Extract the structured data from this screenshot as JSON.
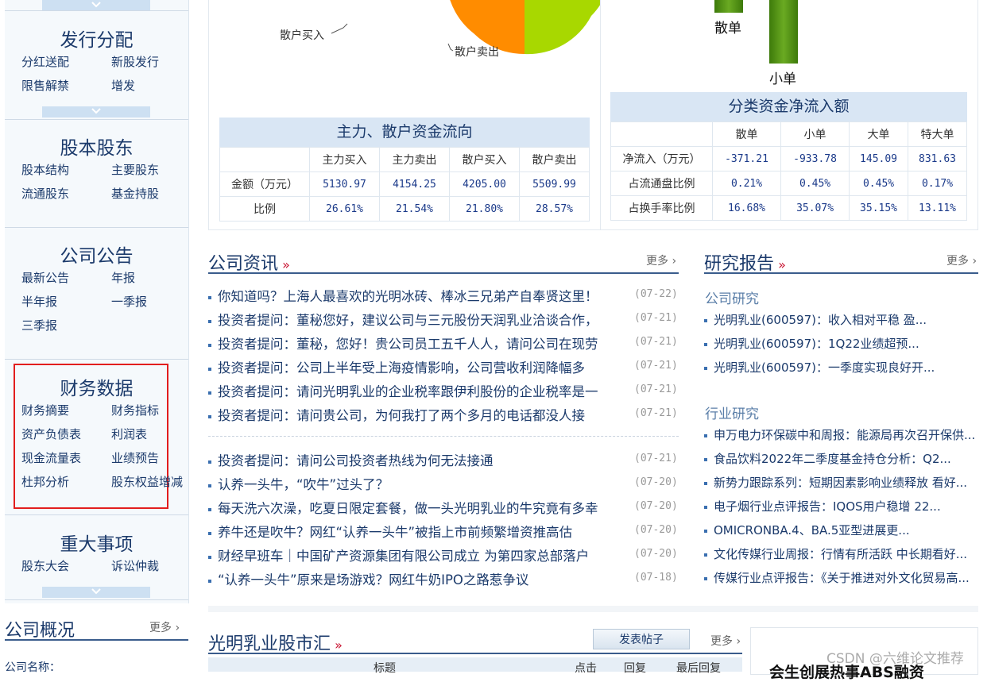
{
  "sidebar": {
    "sections": [
      {
        "title": "发行分配",
        "items": [
          "分红送配",
          "新股发行",
          "限售解禁",
          "增发"
        ]
      },
      {
        "title": "股本股东",
        "items": [
          "股本结构",
          "主要股东",
          "流通股东",
          "基金持股"
        ]
      },
      {
        "title": "公司公告",
        "items": [
          "最新公告",
          "年报",
          "半年报",
          "一季报",
          "三季报"
        ]
      },
      {
        "title": "财务数据",
        "items": [
          "财务摘要",
          "财务指标",
          "资产负债表",
          "利润表",
          "现金流量表",
          "业绩预告",
          "杜邦分析",
          "股东权益增减"
        ]
      },
      {
        "title": "重大事项",
        "items": [
          "股东大会",
          "诉讼仲裁"
        ]
      }
    ],
    "overview": {
      "title": "公司概况",
      "more": "更多",
      "first_field": "公司名称："
    }
  },
  "flow_pie": {
    "labels": [
      "散户买入",
      "散户卖出"
    ],
    "colors": [
      "#ff8c00",
      "#a8d800"
    ]
  },
  "flow_bar": {
    "labels": [
      "散单",
      "小单"
    ],
    "color": "#4a8c10"
  },
  "flow_table": {
    "caption": "主力、散户资金流向",
    "headers": [
      "主力买入",
      "主力卖出",
      "散户买入",
      "散户卖出"
    ],
    "rows": [
      {
        "label": "金额（万元）",
        "values": [
          "5130.97",
          "4154.25",
          "4205.00",
          "5509.99"
        ]
      },
      {
        "label": "比例",
        "values": [
          "26.61%",
          "21.54%",
          "21.80%",
          "28.57%"
        ]
      }
    ]
  },
  "net_table": {
    "caption": "分类资金净流入额",
    "headers": [
      "散单",
      "小单",
      "大单",
      "特大单"
    ],
    "rows": [
      {
        "label": "净流入（万元）",
        "values": [
          "-371.21",
          "-933.78",
          "145.09",
          "831.63"
        ]
      },
      {
        "label": "占流通盘比例",
        "values": [
          "0.21%",
          "0.45%",
          "0.45%",
          "0.17%"
        ]
      },
      {
        "label": "占换手率比例",
        "values": [
          "16.68%",
          "35.07%",
          "35.15%",
          "13.11%"
        ]
      }
    ]
  },
  "news": {
    "title": "公司资讯",
    "more": "更多",
    "group1": [
      {
        "text": "你知道吗？上海人最喜欢的光明冰砖、棒冰三兄弟产自奉贤这里！",
        "date": "(07-22)"
      },
      {
        "text": "投资者提问：董秘您好，建议公司与三元股份天润乳业洽谈合作，",
        "date": "(07-21)"
      },
      {
        "text": "投资者提问：董秘，您好！贵公司员工五千人人，请问公司在现劳",
        "date": "(07-21)"
      },
      {
        "text": "投资者提问：公司上半年受上海疫情影响，公司营收利润降幅多",
        "date": "(07-21)"
      },
      {
        "text": "投资者提问：请问光明乳业的企业税率跟伊利股份的企业税率是一",
        "date": "(07-21)"
      },
      {
        "text": "投资者提问：请问贵公司，为何我打了两个多月的电话都没人接",
        "date": "(07-21)"
      }
    ],
    "group2": [
      {
        "text": "投资者提问：请问公司投资者热线为何无法接通",
        "date": "(07-21)"
      },
      {
        "text": "认养一头牛，“吹牛”过头了？",
        "date": "(07-20)"
      },
      {
        "text": "每天洗六次澡，吃夏日限定套餐，做一头光明乳业的牛究竟有多幸",
        "date": "(07-20)"
      },
      {
        "text": "养牛还是吹牛？网红“认养一头牛”被指上市前频繁增资推高估",
        "date": "(07-20)"
      },
      {
        "text": "财经早班车｜中国矿产资源集团有限公司成立 为第四家总部落户",
        "date": "(07-20)"
      },
      {
        "text": "“认养一头牛”原来是场游戏？网红牛奶IPO之路惹争议",
        "date": "(07-18)"
      }
    ]
  },
  "research": {
    "title": "研究报告",
    "more": "更多",
    "company_label": "公司研究",
    "company": [
      "光明乳业(600597)：收入相对平稳 盈...",
      "光明乳业(600597)：1Q22业绩超预...",
      "光明乳业(600597)：一季度实现良好开..."
    ],
    "industry_label": "行业研究",
    "industry": [
      "申万电力环保碳中和周报：能源局再次召开保供...",
      "食品饮料2022年二季度基金持仓分析：Q2...",
      "新势力跟踪系列：短期因素影响业绩释放 看好...",
      "电子烟行业点评报告：IQOS用户稳增 22...",
      "OMICRONBA.4、BA.5亚型进展更...",
      "文化传媒行业周报：行情有所活跃 中长期看好...",
      "传媒行业点评报告：《关于推进对外文化贸易高..."
    ]
  },
  "forum": {
    "title": "光明乳业股市汇",
    "post_button": "发表帖子",
    "more": "更多",
    "columns": [
      "标题",
      "点击",
      "回复",
      "最后回复"
    ]
  },
  "ad": {
    "text": "会生创展热事ABS融资"
  },
  "watermark": "CSDN @六维论文推荐"
}
